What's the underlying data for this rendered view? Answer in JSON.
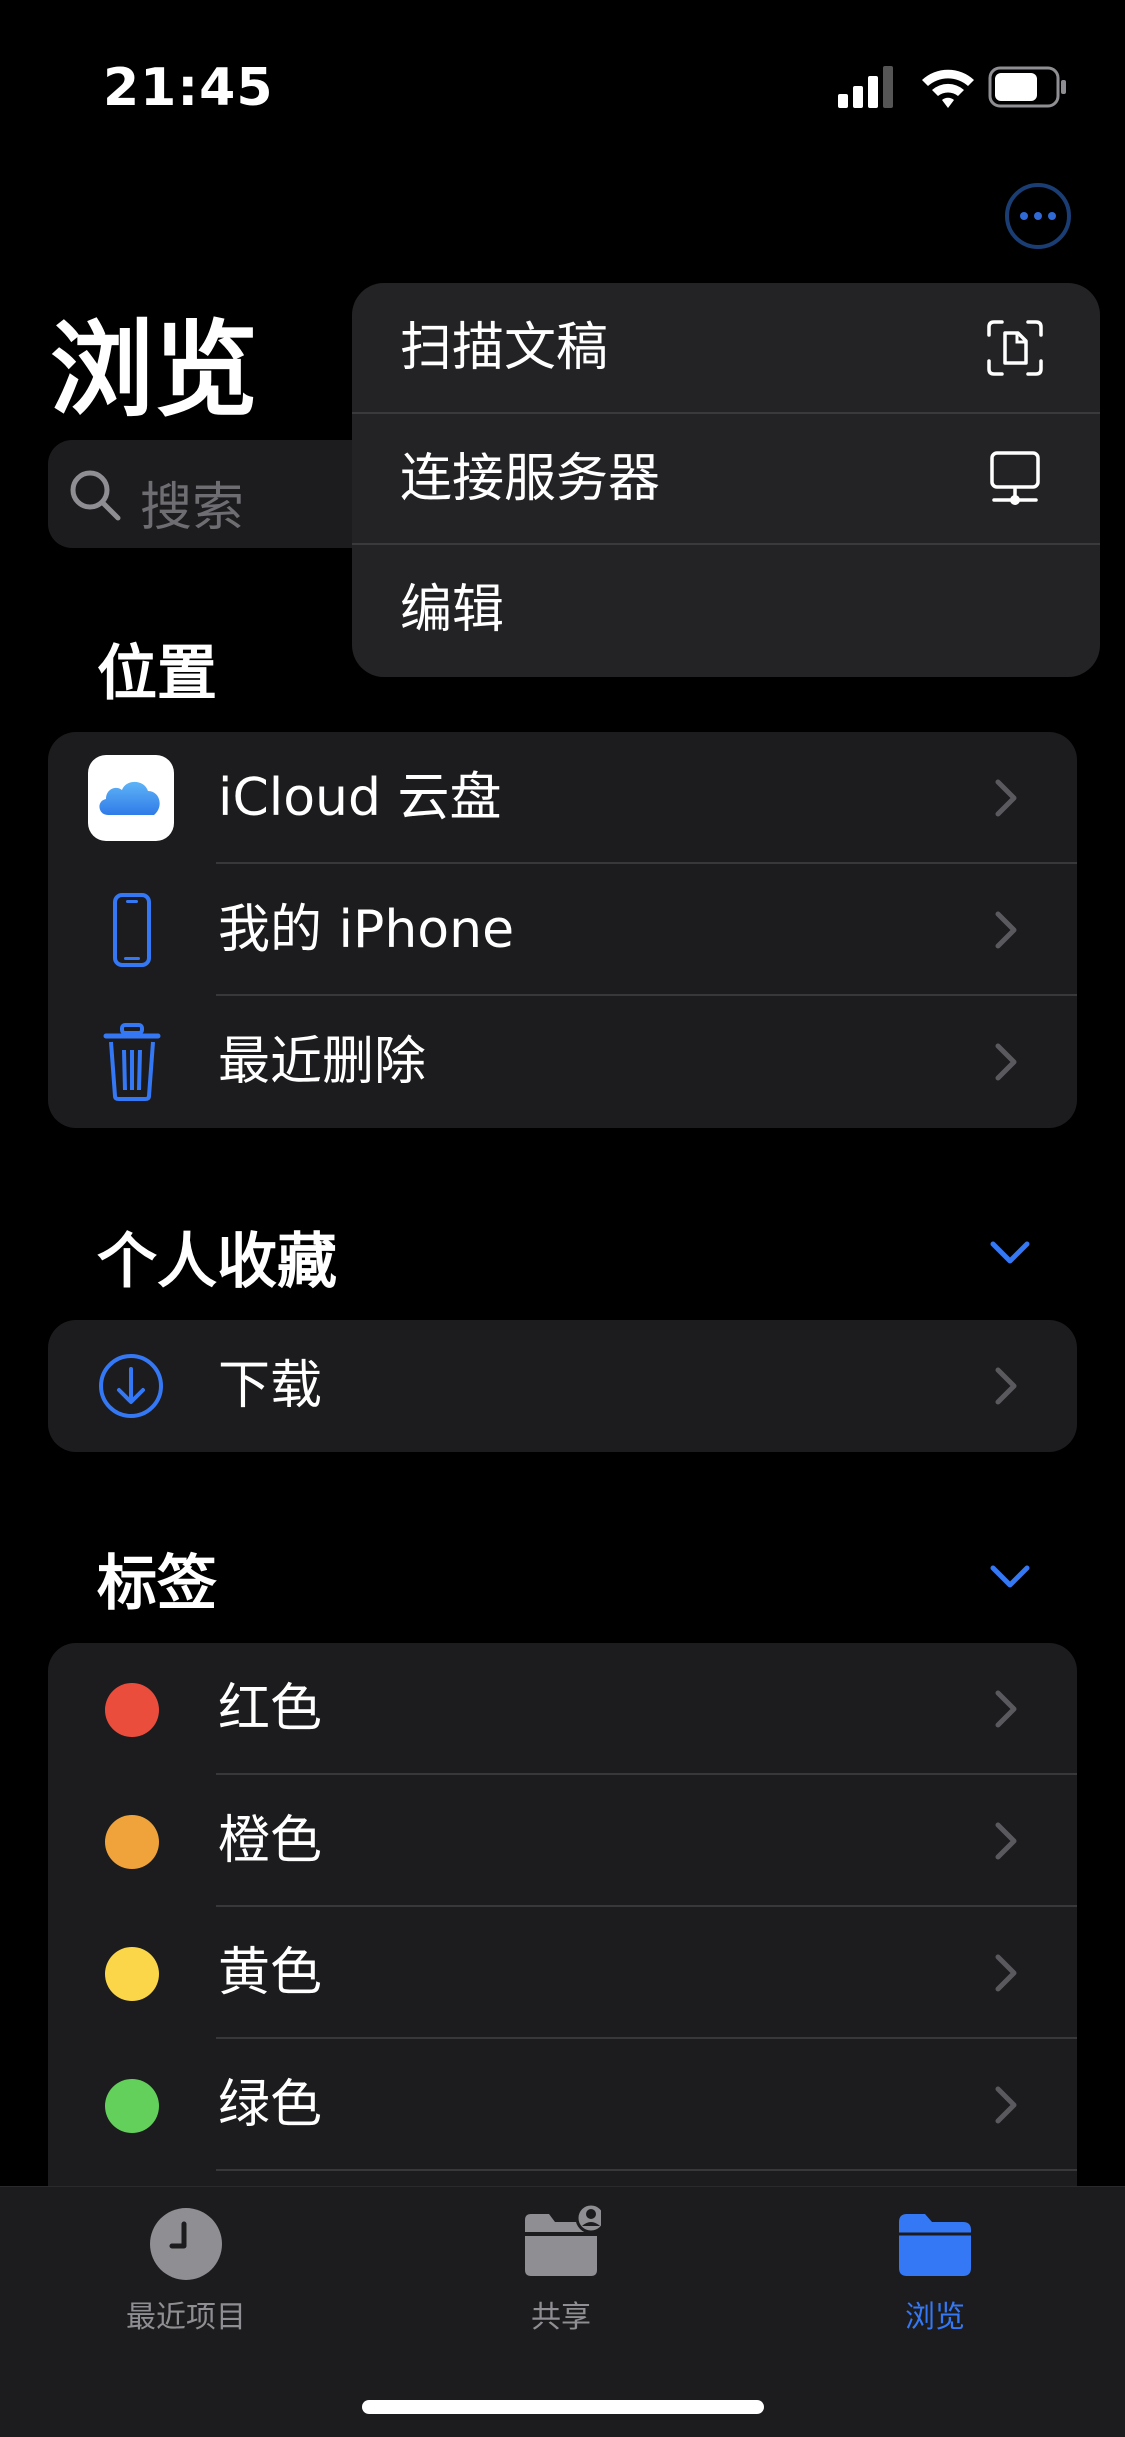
{
  "status_bar": {
    "time": "21:45"
  },
  "page": {
    "title": "浏览"
  },
  "search": {
    "placeholder": "搜索"
  },
  "menu": {
    "items": [
      {
        "label": "扫描文稿",
        "icon": "doc-scan-icon"
      },
      {
        "label": "连接服务器",
        "icon": "server-icon"
      },
      {
        "label": "编辑"
      }
    ]
  },
  "locations": {
    "title": "位置",
    "items": [
      {
        "label": "iCloud 云盘",
        "icon": "icloud-icon"
      },
      {
        "label": "我的 iPhone",
        "icon": "iphone-icon"
      },
      {
        "label": "最近删除",
        "icon": "trash-icon"
      }
    ]
  },
  "favorites": {
    "title": "个人收藏",
    "items": [
      {
        "label": "下载",
        "icon": "download-icon"
      }
    ]
  },
  "tags": {
    "title": "标签",
    "items": [
      {
        "label": "红色",
        "color": "#eb4d3d"
      },
      {
        "label": "橙色",
        "color": "#f0a33a"
      },
      {
        "label": "黄色",
        "color": "#fad648"
      },
      {
        "label": "绿色",
        "color": "#62d05b"
      }
    ]
  },
  "tabbar": {
    "items": [
      {
        "label": "最近项目",
        "icon": "clock-icon",
        "active": false
      },
      {
        "label": "共享",
        "icon": "shared-folder-icon",
        "active": false
      },
      {
        "label": "浏览",
        "icon": "folder-icon",
        "active": true
      }
    ]
  },
  "colors": {
    "accent": "#3478f6",
    "background": "#000000",
    "card": "#1c1c1e"
  }
}
